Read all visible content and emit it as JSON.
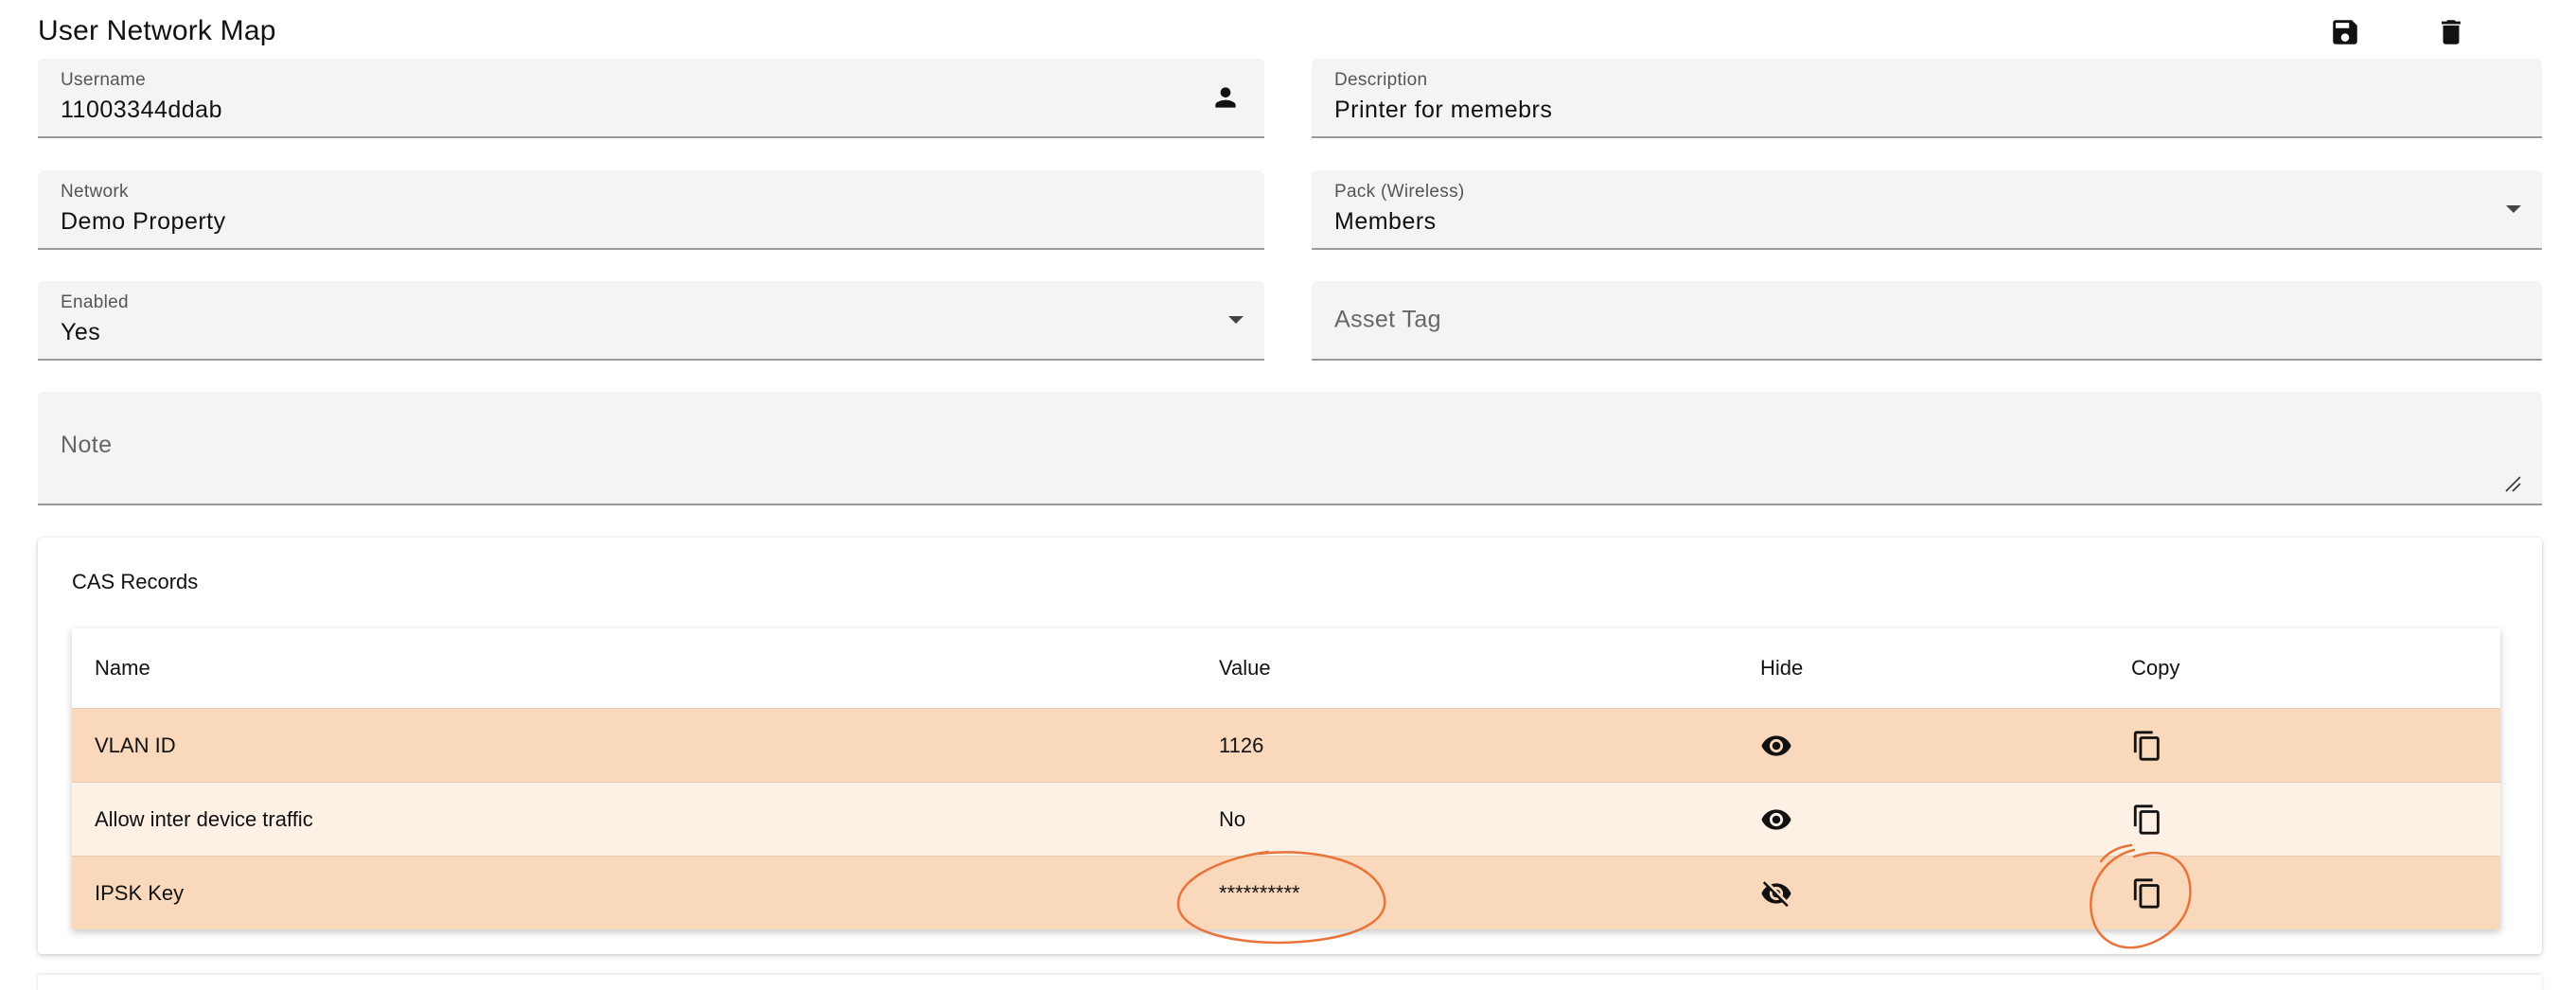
{
  "header": {
    "title": "User Network Map",
    "save_icon": "save-icon",
    "delete_icon": "delete-icon"
  },
  "form": {
    "username": {
      "label": "Username",
      "value": "11003344ddab",
      "icon": "person-icon"
    },
    "description": {
      "label": "Description",
      "value": "Printer for memebrs"
    },
    "network": {
      "label": "Network",
      "value": "Demo Property"
    },
    "pack": {
      "label": "Pack (Wireless)",
      "value": "Members"
    },
    "enabled": {
      "label": "Enabled",
      "value": "Yes"
    },
    "asset_tag": {
      "placeholder": "Asset Tag"
    },
    "note": {
      "placeholder": "Note"
    }
  },
  "cas": {
    "title": "CAS Records",
    "columns": [
      "Name",
      "Value",
      "Hide",
      "Copy"
    ],
    "rows": [
      {
        "name": "VLAN ID",
        "value": "1126",
        "hide_icon": "eye-icon",
        "copy_icon": "copy-icon"
      },
      {
        "name": "Allow inter device traffic",
        "value": "No",
        "hide_icon": "eye-icon",
        "copy_icon": "copy-icon"
      },
      {
        "name": "IPSK Key",
        "value": "**********",
        "hide_icon": "eye-off-icon",
        "copy_icon": "copy-icon"
      }
    ]
  },
  "colors": {
    "row_dark": "#f9d8bb",
    "row_light": "#fdf1e6",
    "field_bg": "#f4f4f4",
    "annotation": "#e8743b"
  }
}
